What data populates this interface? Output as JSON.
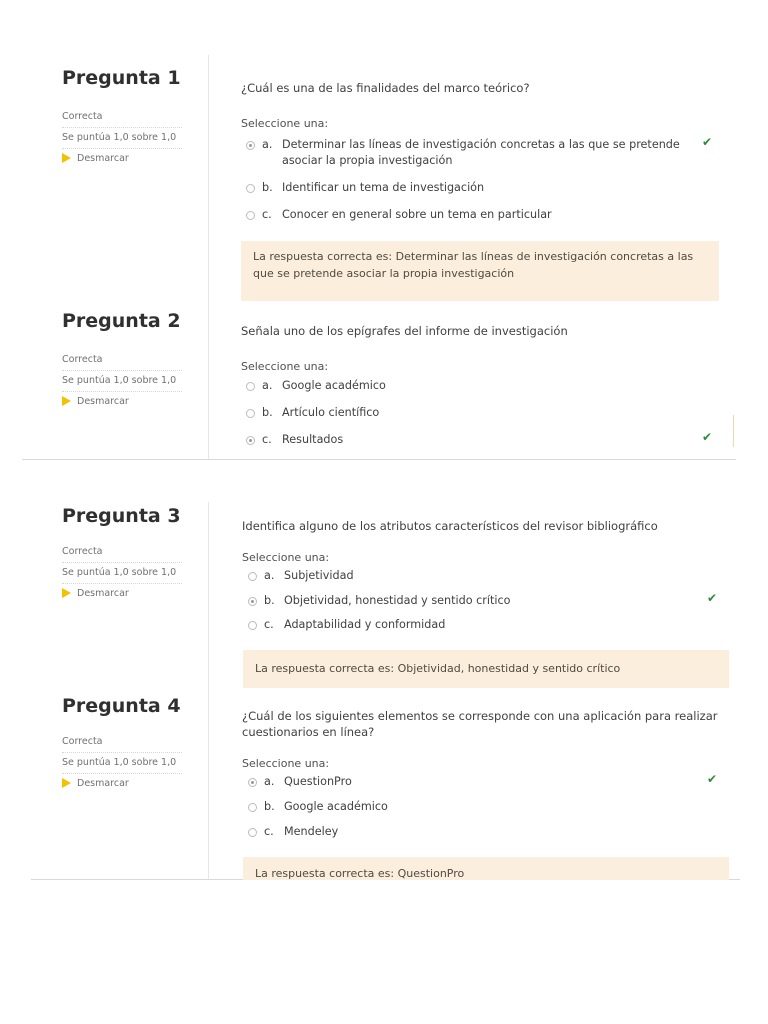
{
  "q1": {
    "title": "Pregunta 1",
    "status": "Correcta",
    "score": "Se puntúa 1,0 sobre 1,0",
    "flag": "Desmarcar",
    "question": "¿Cuál es una de las finalidades del marco teórico?",
    "prompt": "Seleccione una:",
    "options": [
      {
        "letter": "a.",
        "text_line1": "Determinar las líneas de investigación concretas a las que se pretende",
        "text_line2": "asociar la propia investigación",
        "selected": true,
        "correct": true
      },
      {
        "letter": "b.",
        "text": "Identificar un tema de investigación",
        "selected": false
      },
      {
        "letter": "c.",
        "text": "Conocer en general sobre un tema en particular",
        "selected": false
      }
    ],
    "feedback_line1": "La respuesta correcta es: Determinar las líneas de investigación concretas a las",
    "feedback_line2": "que se pretende asociar la propia investigación"
  },
  "q2": {
    "title": "Pregunta 2",
    "status": "Correcta",
    "score": "Se puntúa 1,0 sobre 1,0",
    "flag": "Desmarcar",
    "question": "Señala uno de los epígrafes del informe de investigación",
    "prompt": "Seleccione una:",
    "options": [
      {
        "letter": "a.",
        "text": "Google académico",
        "selected": false
      },
      {
        "letter": "b.",
        "text": "Artículo científico",
        "selected": false
      },
      {
        "letter": "c.",
        "text": "Resultados",
        "selected": true,
        "correct": true
      }
    ]
  },
  "q3": {
    "title": "Pregunta 3",
    "status": "Correcta",
    "score": "Se puntúa 1,0 sobre 1,0",
    "flag": "Desmarcar",
    "question": "Identifica alguno de los atributos característicos del revisor bibliográfico",
    "prompt": "Seleccione una:",
    "options": [
      {
        "letter": "a.",
        "text": "Subjetividad",
        "selected": false
      },
      {
        "letter": "b.",
        "text": "Objetividad, honestidad y sentido crítico",
        "selected": true,
        "correct": true
      },
      {
        "letter": "c.",
        "text": "Adaptabilidad y conformidad",
        "selected": false
      }
    ],
    "feedback": "La respuesta correcta es: Objetividad, honestidad y sentido crítico"
  },
  "q4": {
    "title": "Pregunta 4",
    "status": "Correcta",
    "score": "Se puntúa 1,0 sobre 1,0",
    "flag": "Desmarcar",
    "question_line1": "¿Cuál de los siguientes elementos se corresponde con una aplicación para realizar",
    "question_line2": "cuestionarios en línea?",
    "prompt": "Seleccione una:",
    "options": [
      {
        "letter": "a.",
        "text": "QuestionPro",
        "selected": true,
        "correct": true
      },
      {
        "letter": "b.",
        "text": "Google académico",
        "selected": false
      },
      {
        "letter": "c.",
        "text": "Mendeley",
        "selected": false
      }
    ],
    "feedback": "La respuesta correcta es: QuestionPro"
  },
  "icons": {
    "check": "check-icon",
    "flag": "flag-icon",
    "radio": "radio-icon"
  },
  "colors": {
    "check": "#2e8b3a",
    "flag": "#f2c200",
    "feedback_bg": "#fbeedc"
  }
}
